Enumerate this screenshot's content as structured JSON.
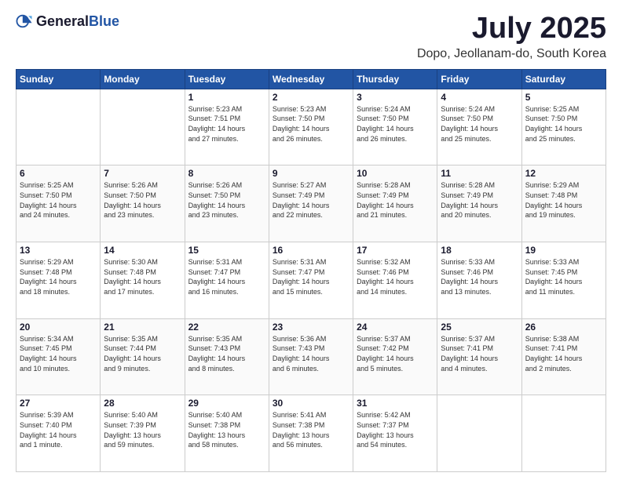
{
  "logo": {
    "text_general": "General",
    "text_blue": "Blue"
  },
  "header": {
    "month": "July 2025",
    "location": "Dopo, Jeollanam-do, South Korea"
  },
  "days_of_week": [
    "Sunday",
    "Monday",
    "Tuesday",
    "Wednesday",
    "Thursday",
    "Friday",
    "Saturday"
  ],
  "weeks": [
    [
      {
        "day": "",
        "sunrise": "",
        "sunset": "",
        "daylight": ""
      },
      {
        "day": "",
        "sunrise": "",
        "sunset": "",
        "daylight": ""
      },
      {
        "day": "1",
        "sunrise": "Sunrise: 5:23 AM",
        "sunset": "Sunset: 7:51 PM",
        "daylight": "Daylight: 14 hours and 27 minutes."
      },
      {
        "day": "2",
        "sunrise": "Sunrise: 5:23 AM",
        "sunset": "Sunset: 7:50 PM",
        "daylight": "Daylight: 14 hours and 26 minutes."
      },
      {
        "day": "3",
        "sunrise": "Sunrise: 5:24 AM",
        "sunset": "Sunset: 7:50 PM",
        "daylight": "Daylight: 14 hours and 26 minutes."
      },
      {
        "day": "4",
        "sunrise": "Sunrise: 5:24 AM",
        "sunset": "Sunset: 7:50 PM",
        "daylight": "Daylight: 14 hours and 25 minutes."
      },
      {
        "day": "5",
        "sunrise": "Sunrise: 5:25 AM",
        "sunset": "Sunset: 7:50 PM",
        "daylight": "Daylight: 14 hours and 25 minutes."
      }
    ],
    [
      {
        "day": "6",
        "sunrise": "Sunrise: 5:25 AM",
        "sunset": "Sunset: 7:50 PM",
        "daylight": "Daylight: 14 hours and 24 minutes."
      },
      {
        "day": "7",
        "sunrise": "Sunrise: 5:26 AM",
        "sunset": "Sunset: 7:50 PM",
        "daylight": "Daylight: 14 hours and 23 minutes."
      },
      {
        "day": "8",
        "sunrise": "Sunrise: 5:26 AM",
        "sunset": "Sunset: 7:50 PM",
        "daylight": "Daylight: 14 hours and 23 minutes."
      },
      {
        "day": "9",
        "sunrise": "Sunrise: 5:27 AM",
        "sunset": "Sunset: 7:49 PM",
        "daylight": "Daylight: 14 hours and 22 minutes."
      },
      {
        "day": "10",
        "sunrise": "Sunrise: 5:28 AM",
        "sunset": "Sunset: 7:49 PM",
        "daylight": "Daylight: 14 hours and 21 minutes."
      },
      {
        "day": "11",
        "sunrise": "Sunrise: 5:28 AM",
        "sunset": "Sunset: 7:49 PM",
        "daylight": "Daylight: 14 hours and 20 minutes."
      },
      {
        "day": "12",
        "sunrise": "Sunrise: 5:29 AM",
        "sunset": "Sunset: 7:48 PM",
        "daylight": "Daylight: 14 hours and 19 minutes."
      }
    ],
    [
      {
        "day": "13",
        "sunrise": "Sunrise: 5:29 AM",
        "sunset": "Sunset: 7:48 PM",
        "daylight": "Daylight: 14 hours and 18 minutes."
      },
      {
        "day": "14",
        "sunrise": "Sunrise: 5:30 AM",
        "sunset": "Sunset: 7:48 PM",
        "daylight": "Daylight: 14 hours and 17 minutes."
      },
      {
        "day": "15",
        "sunrise": "Sunrise: 5:31 AM",
        "sunset": "Sunset: 7:47 PM",
        "daylight": "Daylight: 14 hours and 16 minutes."
      },
      {
        "day": "16",
        "sunrise": "Sunrise: 5:31 AM",
        "sunset": "Sunset: 7:47 PM",
        "daylight": "Daylight: 14 hours and 15 minutes."
      },
      {
        "day": "17",
        "sunrise": "Sunrise: 5:32 AM",
        "sunset": "Sunset: 7:46 PM",
        "daylight": "Daylight: 14 hours and 14 minutes."
      },
      {
        "day": "18",
        "sunrise": "Sunrise: 5:33 AM",
        "sunset": "Sunset: 7:46 PM",
        "daylight": "Daylight: 14 hours and 13 minutes."
      },
      {
        "day": "19",
        "sunrise": "Sunrise: 5:33 AM",
        "sunset": "Sunset: 7:45 PM",
        "daylight": "Daylight: 14 hours and 11 minutes."
      }
    ],
    [
      {
        "day": "20",
        "sunrise": "Sunrise: 5:34 AM",
        "sunset": "Sunset: 7:45 PM",
        "daylight": "Daylight: 14 hours and 10 minutes."
      },
      {
        "day": "21",
        "sunrise": "Sunrise: 5:35 AM",
        "sunset": "Sunset: 7:44 PM",
        "daylight": "Daylight: 14 hours and 9 minutes."
      },
      {
        "day": "22",
        "sunrise": "Sunrise: 5:35 AM",
        "sunset": "Sunset: 7:43 PM",
        "daylight": "Daylight: 14 hours and 8 minutes."
      },
      {
        "day": "23",
        "sunrise": "Sunrise: 5:36 AM",
        "sunset": "Sunset: 7:43 PM",
        "daylight": "Daylight: 14 hours and 6 minutes."
      },
      {
        "day": "24",
        "sunrise": "Sunrise: 5:37 AM",
        "sunset": "Sunset: 7:42 PM",
        "daylight": "Daylight: 14 hours and 5 minutes."
      },
      {
        "day": "25",
        "sunrise": "Sunrise: 5:37 AM",
        "sunset": "Sunset: 7:41 PM",
        "daylight": "Daylight: 14 hours and 4 minutes."
      },
      {
        "day": "26",
        "sunrise": "Sunrise: 5:38 AM",
        "sunset": "Sunset: 7:41 PM",
        "daylight": "Daylight: 14 hours and 2 minutes."
      }
    ],
    [
      {
        "day": "27",
        "sunrise": "Sunrise: 5:39 AM",
        "sunset": "Sunset: 7:40 PM",
        "daylight": "Daylight: 14 hours and 1 minute."
      },
      {
        "day": "28",
        "sunrise": "Sunrise: 5:40 AM",
        "sunset": "Sunset: 7:39 PM",
        "daylight": "Daylight: 13 hours and 59 minutes."
      },
      {
        "day": "29",
        "sunrise": "Sunrise: 5:40 AM",
        "sunset": "Sunset: 7:38 PM",
        "daylight": "Daylight: 13 hours and 58 minutes."
      },
      {
        "day": "30",
        "sunrise": "Sunrise: 5:41 AM",
        "sunset": "Sunset: 7:38 PM",
        "daylight": "Daylight: 13 hours and 56 minutes."
      },
      {
        "day": "31",
        "sunrise": "Sunrise: 5:42 AM",
        "sunset": "Sunset: 7:37 PM",
        "daylight": "Daylight: 13 hours and 54 minutes."
      },
      {
        "day": "",
        "sunrise": "",
        "sunset": "",
        "daylight": ""
      },
      {
        "day": "",
        "sunrise": "",
        "sunset": "",
        "daylight": ""
      }
    ]
  ]
}
